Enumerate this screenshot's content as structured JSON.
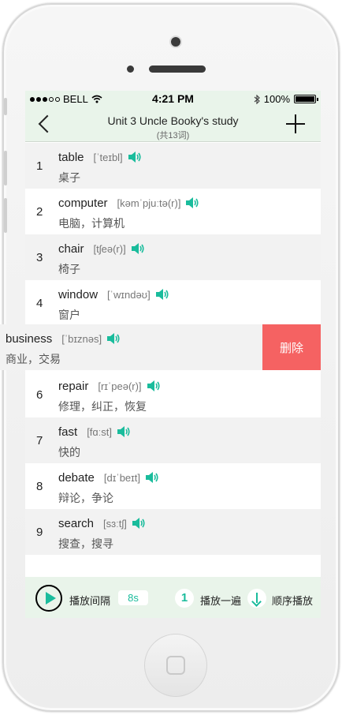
{
  "status_bar": {
    "carrier": "BELL",
    "time": "4:21 PM",
    "battery": "100%"
  },
  "nav": {
    "title": "Unit 3 Uncle Booky's study",
    "subtitle": "(共13词)"
  },
  "words": [
    {
      "num": "1",
      "word": "table",
      "phonetic": "[ˈteɪbl]",
      "meaning": "桌子"
    },
    {
      "num": "2",
      "word": "computer",
      "phonetic": "[kəmˈpjuːtə(r)]",
      "meaning": "电脑，计算机"
    },
    {
      "num": "3",
      "word": "chair",
      "phonetic": "[tʃeə(r)]",
      "meaning": "椅子"
    },
    {
      "num": "4",
      "word": "window",
      "phonetic": "[ˈwɪndəʊ]",
      "meaning": "窗户"
    },
    {
      "num": "",
      "word": "business",
      "phonetic": "[ˈbɪznəs]",
      "meaning": "商业，交易"
    },
    {
      "num": "6",
      "word": "repair",
      "phonetic": "[rɪˈpeə(r)]",
      "meaning": "修理，纠正，恢复"
    },
    {
      "num": "7",
      "word": "fast",
      "phonetic": "[fɑːst]",
      "meaning": "快的"
    },
    {
      "num": "8",
      "word": "debate",
      "phonetic": "[dɪˈbeɪt]",
      "meaning": "辩论，争论"
    },
    {
      "num": "9",
      "word": "search",
      "phonetic": "[sɜːtʃ]",
      "meaning": "搜查，搜寻"
    }
  ],
  "delete_label": "删除",
  "bottom_bar": {
    "interval_label": "播放间隔",
    "interval_value": "8s",
    "repeat_count": "1",
    "repeat_label": "播放一遍",
    "order_label": "顺序播放"
  },
  "colors": {
    "accent": "#1abc9c",
    "delete": "#f56262",
    "bar_bg": "#e9f4ea"
  },
  "icons": {
    "speaker": "speaker-icon",
    "play": "play-icon",
    "back": "back-chevron-icon",
    "add": "plus-icon",
    "order": "arrow-down-icon"
  }
}
